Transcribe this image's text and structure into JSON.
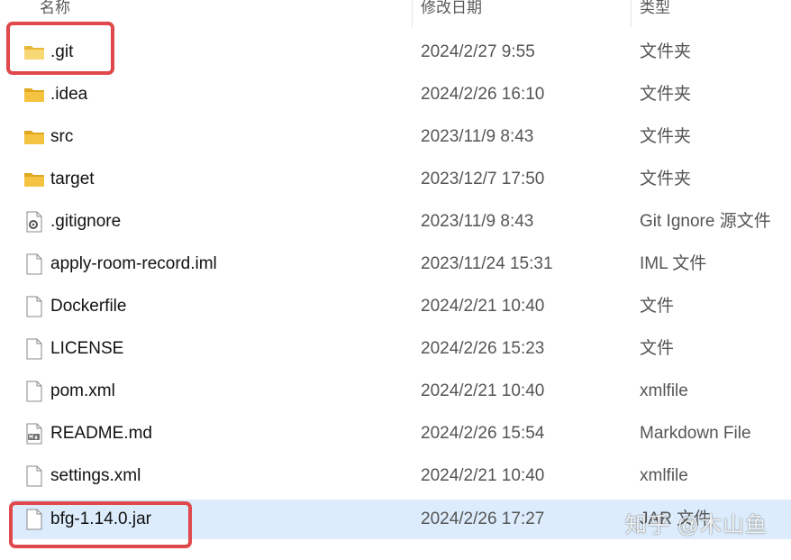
{
  "columns": {
    "name": "名称",
    "date": "修改日期",
    "type": "类型"
  },
  "files": [
    {
      "name": ".git",
      "date": "2024/2/27 9:55",
      "type": "文件夹",
      "icon": "folder-icon"
    },
    {
      "name": ".idea",
      "date": "2024/2/26 16:10",
      "type": "文件夹",
      "icon": "folder-icon"
    },
    {
      "name": "src",
      "date": "2023/11/9 8:43",
      "type": "文件夹",
      "icon": "folder-icon"
    },
    {
      "name": "target",
      "date": "2023/12/7 17:50",
      "type": "文件夹",
      "icon": "folder-icon"
    },
    {
      "name": ".gitignore",
      "date": "2023/11/9 8:43",
      "type": "Git Ignore 源文件",
      "icon": "gear-file-icon"
    },
    {
      "name": "apply-room-record.iml",
      "date": "2023/11/24 15:31",
      "type": "IML 文件",
      "icon": "file-icon"
    },
    {
      "name": "Dockerfile",
      "date": "2024/2/21 10:40",
      "type": "文件",
      "icon": "file-icon"
    },
    {
      "name": "LICENSE",
      "date": "2024/2/26 15:23",
      "type": "文件",
      "icon": "file-icon"
    },
    {
      "name": "pom.xml",
      "date": "2024/2/21 10:40",
      "type": "xmlfile",
      "icon": "file-icon"
    },
    {
      "name": "README.md",
      "date": "2024/2/26 15:54",
      "type": "Markdown File",
      "icon": "markdown-file-icon"
    },
    {
      "name": "settings.xml",
      "date": "2024/2/21 10:40",
      "type": "xmlfile",
      "icon": "file-icon"
    },
    {
      "name": "bfg-1.14.0.jar",
      "date": "2024/2/26 17:27",
      "type": "JAR 文件",
      "icon": "file-icon"
    }
  ],
  "selected_file": "bfg-1.14.0.jar",
  "watermark": "知乎 @木山鱼",
  "colors": {
    "selection": "#dcecfc",
    "highlight_box": "#e0484b",
    "folder": "#f5c342"
  }
}
